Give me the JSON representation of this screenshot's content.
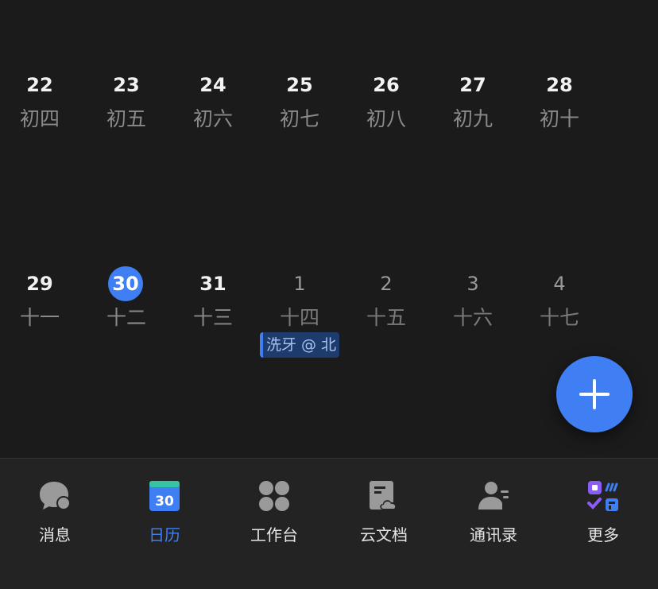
{
  "calendar": {
    "weeks": [
      {
        "days": [
          {
            "date": "22",
            "lunar": "初四"
          },
          {
            "date": "23",
            "lunar": "初五"
          },
          {
            "date": "24",
            "lunar": "初六"
          },
          {
            "date": "25",
            "lunar": "初七"
          },
          {
            "date": "26",
            "lunar": "初八"
          },
          {
            "date": "27",
            "lunar": "初九"
          },
          {
            "date": "28",
            "lunar": "初十"
          }
        ]
      },
      {
        "days": [
          {
            "date": "29",
            "lunar": "十一"
          },
          {
            "date": "30",
            "lunar": "十二",
            "today": true
          },
          {
            "date": "31",
            "lunar": "十三"
          },
          {
            "date": "1",
            "lunar": "十四",
            "other_month": true
          },
          {
            "date": "2",
            "lunar": "十五",
            "other_month": true
          },
          {
            "date": "3",
            "lunar": "十六",
            "other_month": true
          },
          {
            "date": "4",
            "lunar": "十七",
            "other_month": true
          }
        ]
      }
    ],
    "event": {
      "title": "洗牙 @ 北",
      "date": "1"
    }
  },
  "fab": {
    "icon": "plus-icon"
  },
  "tabbar": {
    "tabs": [
      {
        "label": "消息",
        "icon": "chat-bubbles-icon"
      },
      {
        "label": "日历",
        "icon": "calendar-icon",
        "icon_text": "30",
        "active": true
      },
      {
        "label": "工作台",
        "icon": "grid-icon"
      },
      {
        "label": "云文档",
        "icon": "cloud-doc-icon"
      },
      {
        "label": "通讯录",
        "icon": "contacts-icon"
      },
      {
        "label": "更多",
        "icon": "apps-icon"
      }
    ]
  },
  "colors": {
    "accent": "#3f7ef3",
    "background": "#1b1b1b",
    "tabbar": "#232323",
    "event_bg": "#1e3b6e"
  }
}
